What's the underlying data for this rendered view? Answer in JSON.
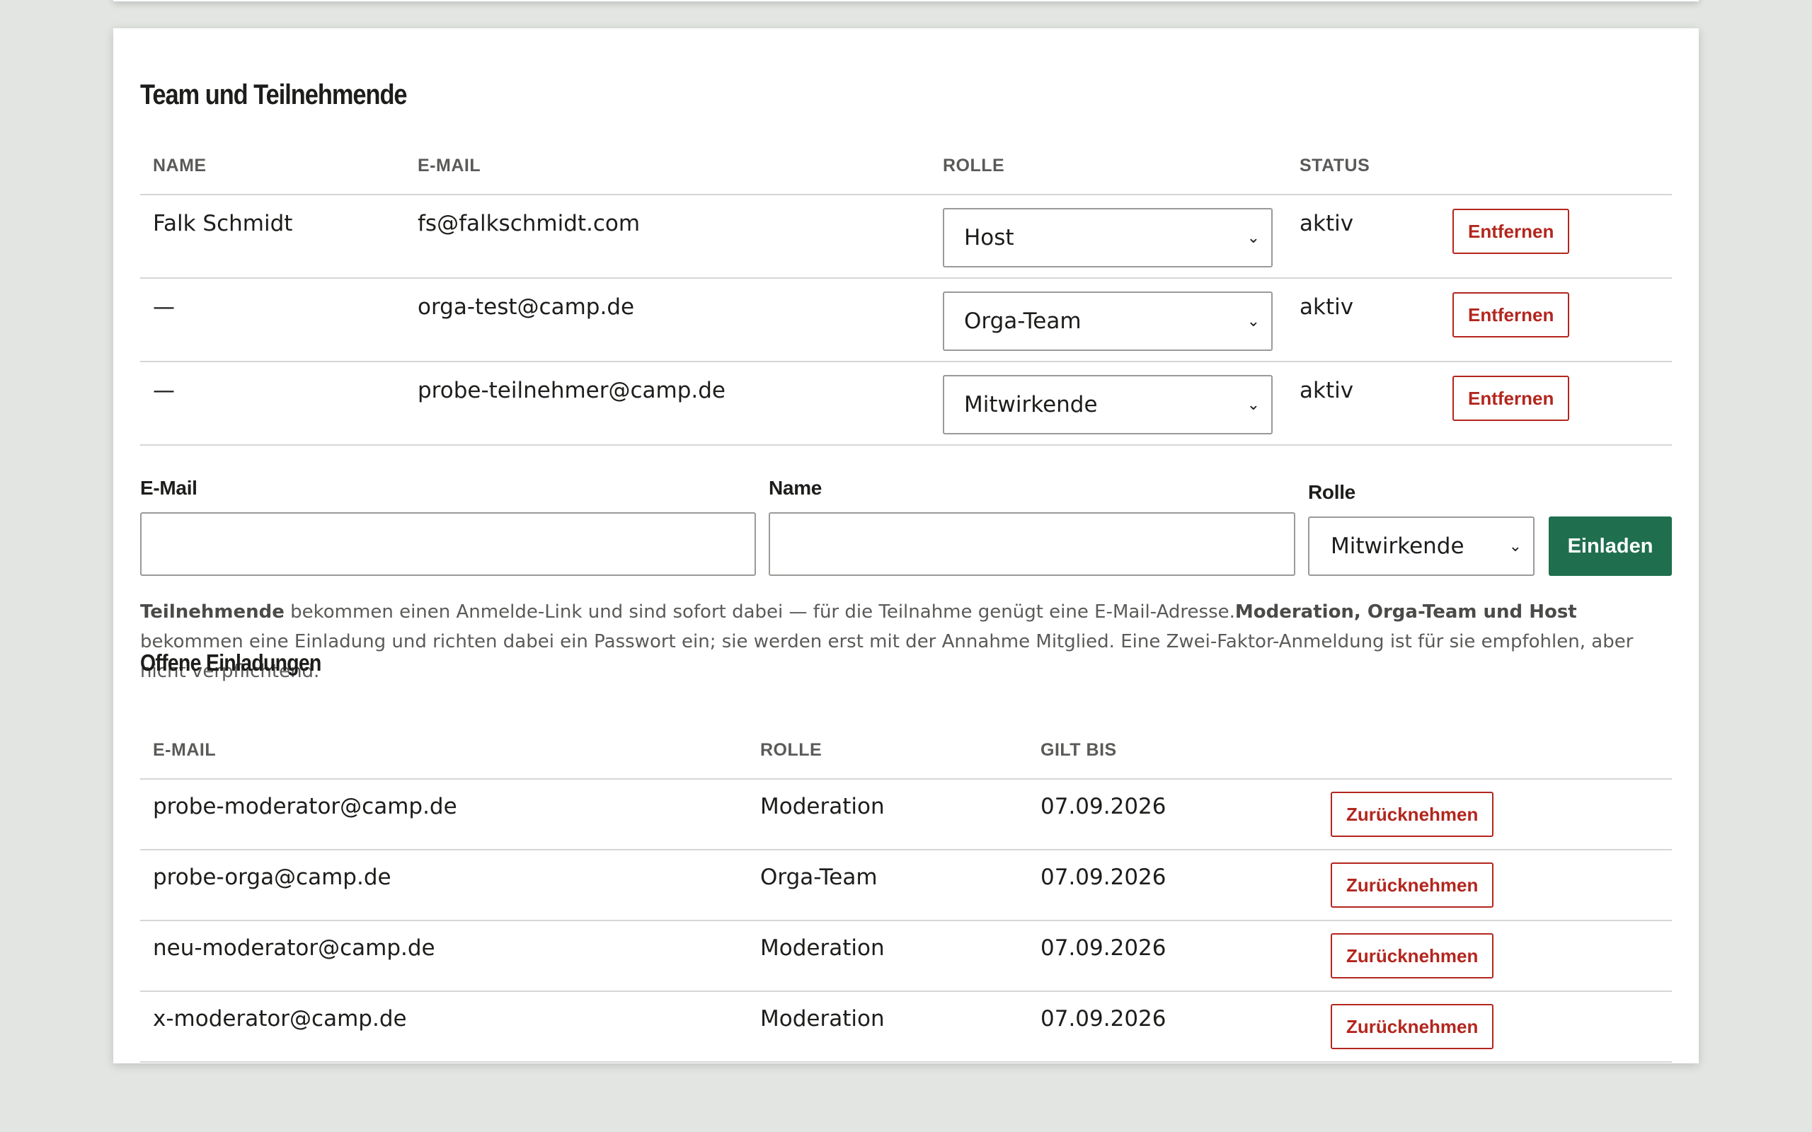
{
  "section_title": "Team und Teilnehmende",
  "members": {
    "columns": [
      "NAME",
      "E-MAIL",
      "ROLLE",
      "STATUS"
    ],
    "rows": [
      {
        "name": "Falk Schmidt",
        "email": "fs@falkschmidt.com",
        "role": "Host",
        "status": "aktiv",
        "action": "Entfernen"
      },
      {
        "name": "—",
        "email": "orga-test@camp.de",
        "role": "Orga-Team",
        "status": "aktiv",
        "action": "Entfernen"
      },
      {
        "name": "—",
        "email": "probe-teilnehmer@camp.de",
        "role": "Mitwirkende",
        "status": "aktiv",
        "action": "Entfernen"
      }
    ]
  },
  "invite_form": {
    "email_label": "E-Mail",
    "email_value": "",
    "name_label": "Name",
    "name_value": "",
    "role_label": "Rolle",
    "role_value": "Mitwirkende",
    "submit_label": "Einladen"
  },
  "hint": {
    "bold1": "Teilnehmende",
    "text1": " bekommen einen Anmelde-Link und sind sofort dabei — für die Teilnahme genügt eine E-Mail-Adresse.",
    "bold2": "Moderation, Orga-Team und Host",
    "text2": " bekommen eine Einladung und richten dabei ein Passwort ein; sie werden erst mit der Annahme Mitglied. Eine Zwei-Faktor-Anmeldung ist für sie empfohlen, aber nicht verpflichtend."
  },
  "invites": {
    "title": "Offene Einladungen",
    "columns": [
      "E-MAIL",
      "ROLLE",
      "GILT BIS"
    ],
    "rows": [
      {
        "email": "probe-moderator@camp.de",
        "role": "Moderation",
        "valid_until": "07.09.2026",
        "action": "Zurücknehmen"
      },
      {
        "email": "probe-orga@camp.de",
        "role": "Orga-Team",
        "valid_until": "07.09.2026",
        "action": "Zurücknehmen"
      },
      {
        "email": "neu-moderator@camp.de",
        "role": "Moderation",
        "valid_until": "07.09.2026",
        "action": "Zurücknehmen"
      },
      {
        "email": "x-moderator@camp.de",
        "role": "Moderation",
        "valid_until": "07.09.2026",
        "action": "Zurücknehmen"
      }
    ]
  },
  "colors": {
    "primary": "#1f6f4f",
    "danger": "#b3261e",
    "background": "#e3e5e2"
  }
}
